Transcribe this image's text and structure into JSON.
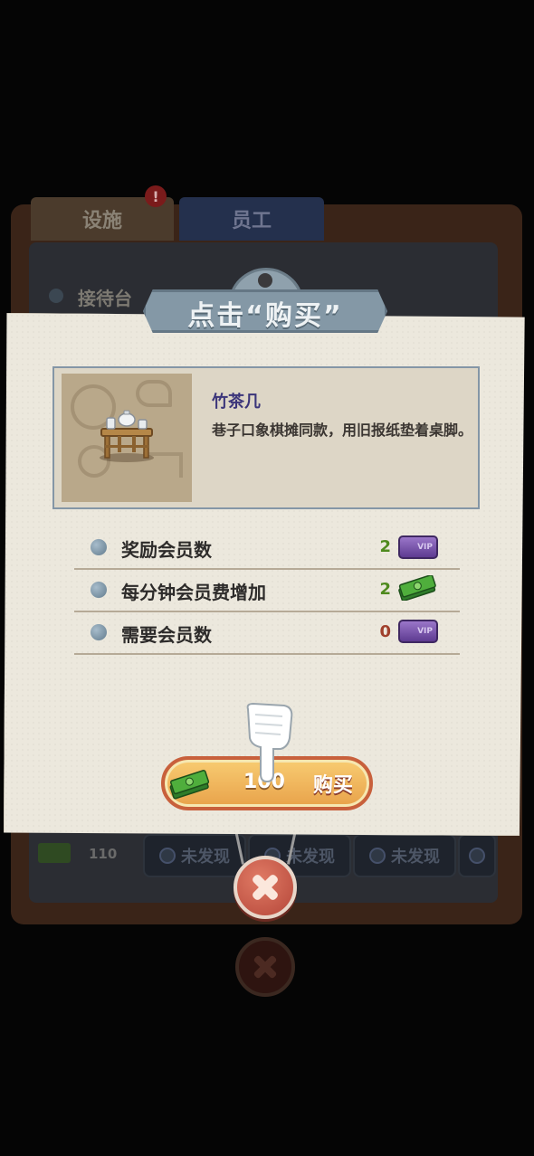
{
  "background": {
    "tabs": [
      "设施",
      "员工"
    ],
    "alert_badge": "!",
    "first_row": "接待台",
    "bottom": {
      "money_value": "110",
      "locked_label": "未发现"
    }
  },
  "dialog": {
    "title": "点击“购买”",
    "item": {
      "name": "竹茶几",
      "description": "巷子口象棋摊同款，用旧报纸垫着桌脚。"
    },
    "stats": [
      {
        "label": "奖励会员数",
        "value": "2",
        "value_color": "#4f8a1e",
        "icon": "vip-icon",
        "icon_text": "VIP"
      },
      {
        "label": "每分钟会员费增加",
        "value": "2",
        "value_color": "#4f8a1e",
        "icon": "cash-icon"
      },
      {
        "label": "需要会员数",
        "value": "0",
        "value_color": "#a0402c",
        "icon": "vip-icon",
        "icon_text": "VIP"
      }
    ],
    "buy": {
      "price": "100",
      "label": "购买"
    }
  },
  "colors": {
    "paper": "#ece8dd",
    "accent_button": "#e8a24a",
    "close_button": "#b5473a"
  }
}
